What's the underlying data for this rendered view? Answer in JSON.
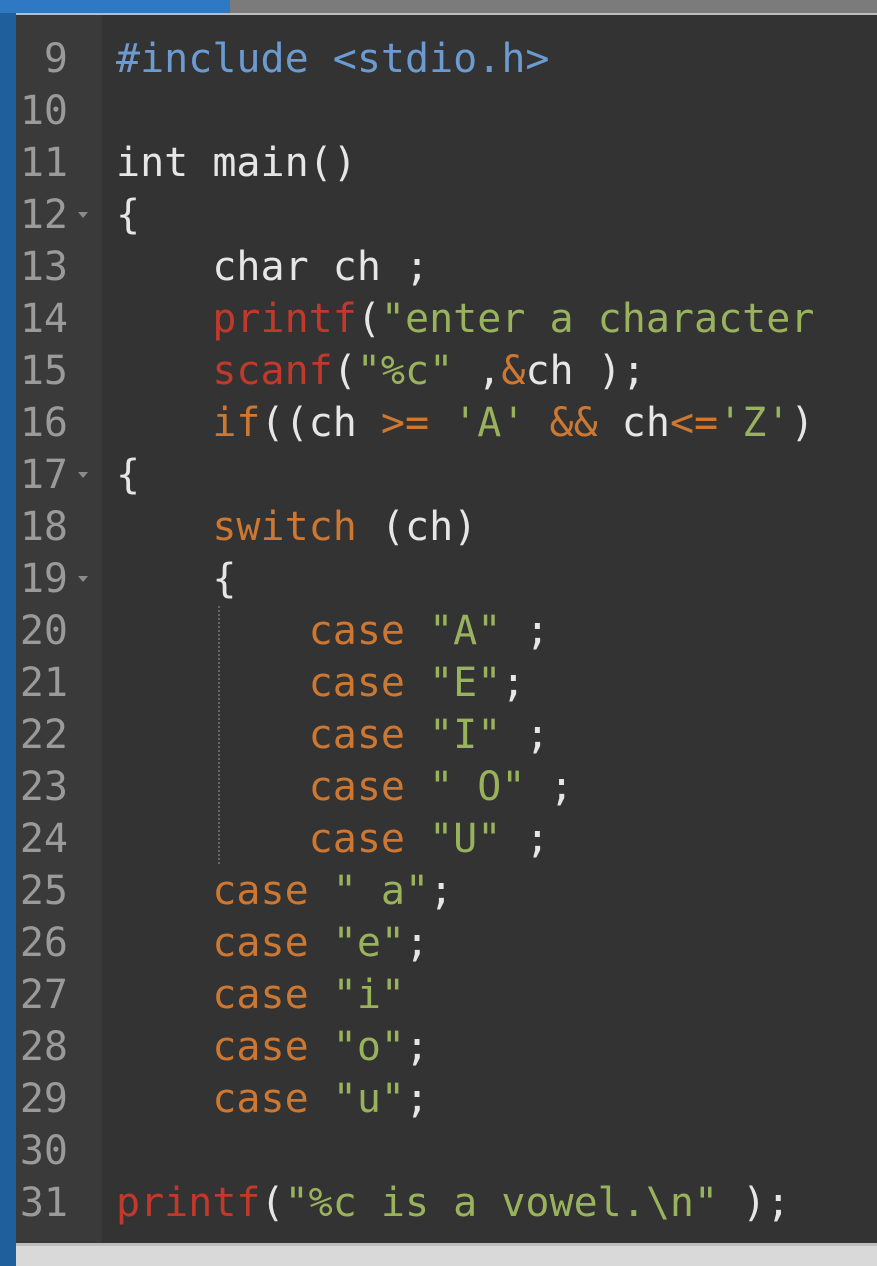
{
  "editor": {
    "line_numbers": [
      "9",
      "10",
      "11",
      "12",
      "13",
      "14",
      "15",
      "16",
      "17",
      "18",
      "19",
      "20",
      "21",
      "22",
      "23",
      "24",
      "25",
      "26",
      "27",
      "28",
      "29",
      "30",
      "31"
    ],
    "lines": [
      {
        "n": "9",
        "tokens": [
          [
            "inc",
            "#include "
          ],
          [
            "inc",
            "<stdio.h>"
          ]
        ]
      },
      {
        "n": "10",
        "tokens": []
      },
      {
        "n": "11",
        "tokens": [
          [
            "pl",
            "int main()"
          ]
        ]
      },
      {
        "n": "12",
        "tokens": [
          [
            "pl",
            "{"
          ]
        ]
      },
      {
        "n": "13",
        "tokens": [
          [
            "pl",
            "    char ch ;"
          ]
        ]
      },
      {
        "n": "14",
        "tokens": [
          [
            "fn",
            "    printf"
          ],
          [
            "pl",
            "("
          ],
          [
            "str",
            "\"enter a character"
          ]
        ]
      },
      {
        "n": "15",
        "tokens": [
          [
            "fn",
            "    scanf"
          ],
          [
            "pl",
            "("
          ],
          [
            "str",
            "\"%c\""
          ],
          [
            "pl",
            " ,"
          ],
          [
            "op",
            "&"
          ],
          [
            "pl",
            "ch );"
          ]
        ]
      },
      {
        "n": "16",
        "tokens": [
          [
            "kw",
            "    if"
          ],
          [
            "pl",
            "((ch "
          ],
          [
            "op",
            ">="
          ],
          [
            "pl",
            " "
          ],
          [
            "str",
            "'A'"
          ],
          [
            "pl",
            " "
          ],
          [
            "op",
            "&&"
          ],
          [
            "pl",
            " ch"
          ],
          [
            "op",
            "<="
          ],
          [
            "str",
            "'Z'"
          ],
          [
            "pl",
            ")"
          ]
        ]
      },
      {
        "n": "17",
        "tokens": [
          [
            "pl",
            "{"
          ]
        ]
      },
      {
        "n": "18",
        "tokens": [
          [
            "kw",
            "    switch"
          ],
          [
            "pl",
            " (ch)"
          ]
        ]
      },
      {
        "n": "19",
        "tokens": [
          [
            "pl",
            "    {"
          ]
        ]
      },
      {
        "n": "20",
        "tokens": [
          [
            "kw",
            "        case"
          ],
          [
            "pl",
            " "
          ],
          [
            "str",
            "\"A\""
          ],
          [
            "pl",
            " ;"
          ]
        ]
      },
      {
        "n": "21",
        "tokens": [
          [
            "kw",
            "        case"
          ],
          [
            "pl",
            " "
          ],
          [
            "str",
            "\"E\""
          ],
          [
            "pl",
            ";"
          ]
        ]
      },
      {
        "n": "22",
        "tokens": [
          [
            "kw",
            "        case"
          ],
          [
            "pl",
            " "
          ],
          [
            "str",
            "\"I\""
          ],
          [
            "pl",
            " ;"
          ]
        ]
      },
      {
        "n": "23",
        "tokens": [
          [
            "kw",
            "        case"
          ],
          [
            "pl",
            " "
          ],
          [
            "str",
            "\" O\""
          ],
          [
            "pl",
            " ;"
          ]
        ]
      },
      {
        "n": "24",
        "tokens": [
          [
            "kw",
            "        case"
          ],
          [
            "pl",
            " "
          ],
          [
            "str",
            "\"U\""
          ],
          [
            "pl",
            " ;"
          ]
        ]
      },
      {
        "n": "25",
        "tokens": [
          [
            "kw",
            "    case"
          ],
          [
            "pl",
            " "
          ],
          [
            "str",
            "\" a\""
          ],
          [
            "pl",
            ";"
          ]
        ]
      },
      {
        "n": "26",
        "tokens": [
          [
            "kw",
            "    case"
          ],
          [
            "pl",
            " "
          ],
          [
            "str",
            "\"e\""
          ],
          [
            "pl",
            ";"
          ]
        ]
      },
      {
        "n": "27",
        "tokens": [
          [
            "kw",
            "    case"
          ],
          [
            "pl",
            " "
          ],
          [
            "str",
            "\"i\""
          ]
        ]
      },
      {
        "n": "28",
        "tokens": [
          [
            "kw",
            "    case"
          ],
          [
            "pl",
            " "
          ],
          [
            "str",
            "\"o\""
          ],
          [
            "pl",
            ";"
          ]
        ]
      },
      {
        "n": "29",
        "tokens": [
          [
            "kw",
            "    case"
          ],
          [
            "pl",
            " "
          ],
          [
            "str",
            "\"u\""
          ],
          [
            "pl",
            ";"
          ]
        ]
      },
      {
        "n": "30",
        "tokens": []
      },
      {
        "n": "31",
        "tokens": [
          [
            "fn",
            "printf"
          ],
          [
            "pl",
            "("
          ],
          [
            "str",
            "\"%c is a vowel.\\n\""
          ],
          [
            "pl",
            " );"
          ]
        ]
      }
    ],
    "fold_markers": [
      "12",
      "17",
      "19"
    ]
  },
  "colors": {
    "keyword": "#cc7832",
    "function": "#c0392b",
    "string": "#98b35c",
    "include": "#6b9bd1",
    "text": "#e6e6e6",
    "line_number": "#9a9a9a",
    "editor_bg": "#333333",
    "gutter_bg": "#3a3a3a"
  }
}
